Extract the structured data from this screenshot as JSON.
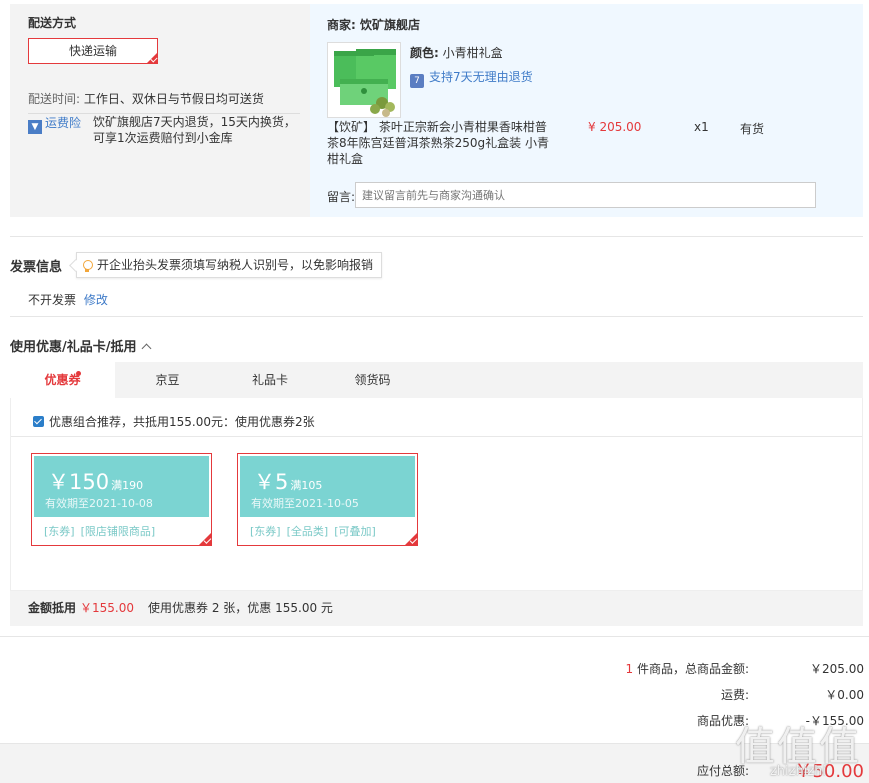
{
  "shipping": {
    "section_label": "配送方式",
    "method_button": "快递运输",
    "time_label": "配送时间:",
    "time_value": "工作日、双休日与节假日均可送货",
    "insurance_label": "运费险",
    "insurance_text": "饮矿旗舰店7天内退货，15天内换货，可享1次运费赔付到小金库"
  },
  "shop": {
    "name": "商家: 饮矿旗舰店",
    "color_label": "颜色:",
    "color_value": "小青柑礼盒",
    "return_policy": "支持7天无理由退货",
    "product_title": "【饮矿】 茶叶正宗新会小青柑果香味柑普茶8年陈宫廷普洱茶熟茶250g礼盒装 小青柑礼盒",
    "price": "¥ 205.00",
    "quantity": "x1",
    "stock": "有货",
    "message_label": "留言:",
    "message_placeholder": "建议留言前先与商家沟通确认"
  },
  "invoice": {
    "title": "发票信息",
    "tip": "开企业抬头发票须填写纳税人识别号，以免影响报销",
    "status": "不开发票",
    "edit_link": "修改"
  },
  "coupons": {
    "title": "使用优惠/礼品卡/抵用",
    "tabs": [
      {
        "label": "优惠券"
      },
      {
        "label": "京豆"
      },
      {
        "label": "礼品卡"
      },
      {
        "label": "领货码"
      }
    ],
    "recommend_text": "优惠组合推荐，共抵用155.00元：使用优惠券2张",
    "items": [
      {
        "amount": "￥150",
        "condition": "满190",
        "expiry": "有效期至2021-10-08",
        "tags": [
          "[东券]",
          "[限店铺限商品]"
        ]
      },
      {
        "amount": "￥5",
        "condition": "满105",
        "expiry": "有效期至2021-10-05",
        "tags": [
          "[东券]",
          "[全品类]",
          "[可叠加]"
        ]
      }
    ],
    "summary_label": "金额抵用",
    "summary_amount": "￥155.00",
    "summary_desc": "使用优惠券 2 张，优惠 155.00 元"
  },
  "totals": {
    "count": "1",
    "count_suffix": " 件商品，总商品金额:",
    "goods_total": "￥205.00",
    "freight_label": "运费:",
    "freight_value": "￥0.00",
    "discount_label": "商品优惠:",
    "discount_value": "-￥155.00",
    "payable_label": "应付总额:",
    "payable_value": "￥50.00"
  },
  "watermark": {
    "main": "值值值",
    "sub": "zhizhizhi"
  },
  "colors": {
    "accent_red": "#e4393c",
    "link_blue": "#3f7bc8",
    "coupon_teal": "#7bd4d2"
  }
}
